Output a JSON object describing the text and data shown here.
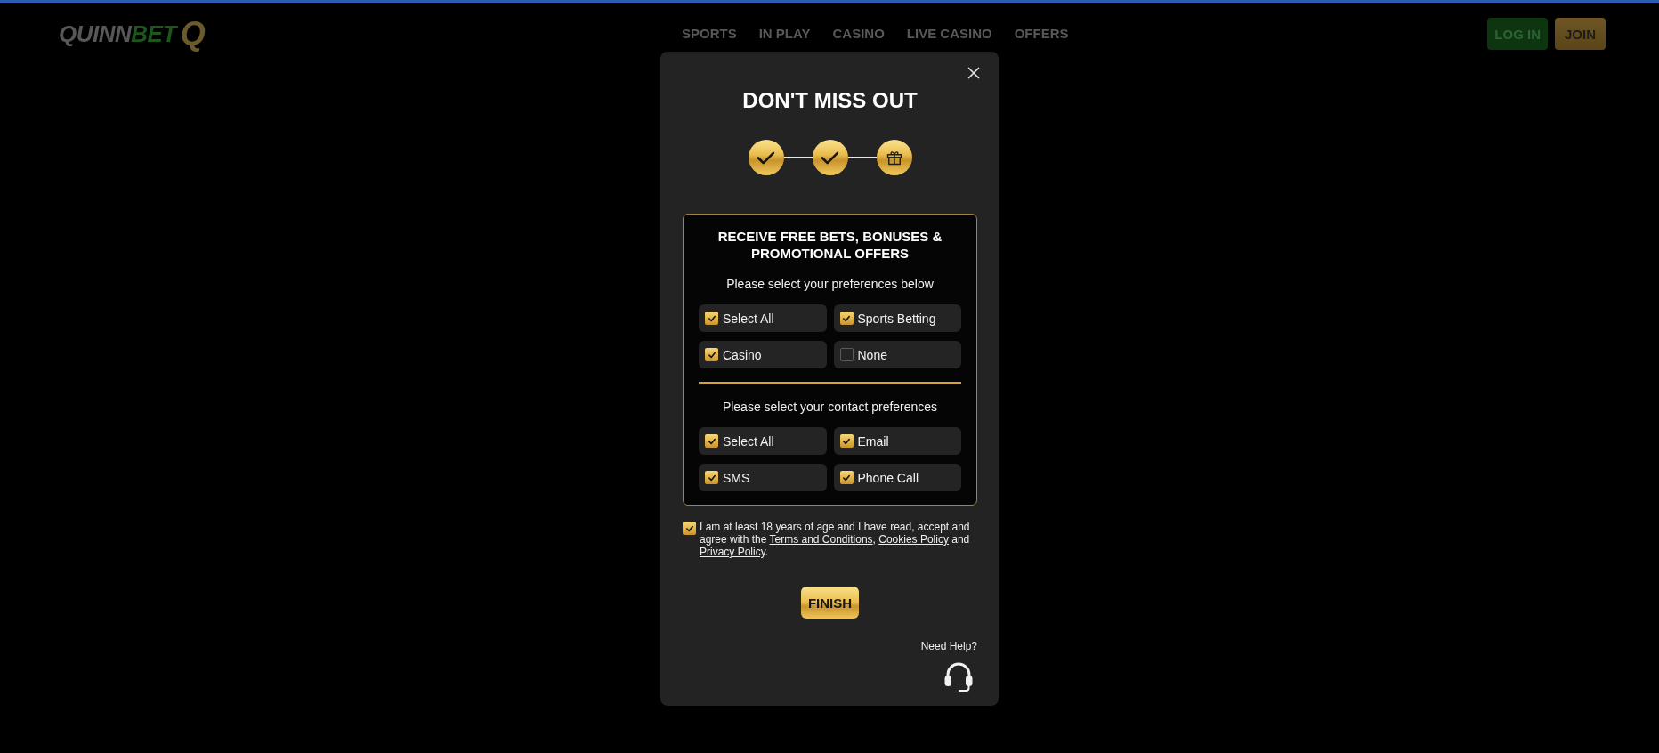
{
  "header": {
    "logo": {
      "part_1": "QUINN",
      "part_2": "BET",
      "mark": "Q"
    },
    "nav": [
      "SPORTS",
      "IN PLAY",
      "CASINO",
      "LIVE CASINO",
      "OFFERS"
    ],
    "buttons": [
      {
        "label": "LOG IN",
        "kind": "login"
      },
      {
        "label": "JOIN",
        "kind": "join"
      }
    ]
  },
  "modal": {
    "title": "DON'T MISS OUT",
    "steps": [
      {
        "kind": "done"
      },
      {
        "kind": "done"
      },
      {
        "kind": "gift"
      }
    ],
    "offers": {
      "heading": "RECEIVE FREE BETS, BONUSES & PROMOTIONAL OFFERS",
      "sections": [
        {
          "prompt": "Please select your preferences below",
          "options": [
            {
              "label": "Select All",
              "checked": true
            },
            {
              "label": "Sports Betting",
              "checked": true
            },
            {
              "label": "Casino",
              "checked": true
            },
            {
              "label": "None",
              "checked": false
            }
          ]
        },
        {
          "prompt": "Please select your contact preferences",
          "options": [
            {
              "label": "Select All",
              "checked": true
            },
            {
              "label": "Email",
              "checked": true
            },
            {
              "label": "SMS",
              "checked": true
            },
            {
              "label": "Phone Call",
              "checked": true
            }
          ]
        }
      ]
    },
    "consent": {
      "checked": true,
      "parts": [
        {
          "kind": "text",
          "text": "I am at least 18 years of age and I have read, accept and agree with the "
        },
        {
          "kind": "link",
          "text": "Terms and Conditions"
        },
        {
          "kind": "text",
          "text": ", "
        },
        {
          "kind": "link",
          "text": "Cookies Policy"
        },
        {
          "kind": "text",
          "text": " and "
        },
        {
          "kind": "link",
          "text": "Privacy Policy"
        },
        {
          "kind": "text",
          "text": "."
        }
      ]
    },
    "finish_button": {
      "label": "FINISH"
    },
    "help": {
      "label": "Need Help?"
    }
  }
}
